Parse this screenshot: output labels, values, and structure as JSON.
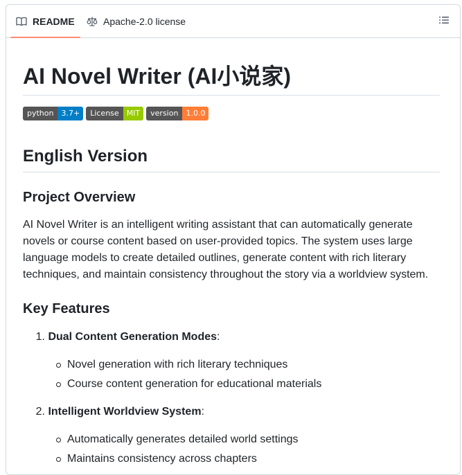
{
  "tabs": {
    "readme": "README",
    "license": "Apache-2.0 license"
  },
  "readme": {
    "title": "AI Novel Writer (AI小说家)",
    "badges": [
      {
        "label": "python",
        "value": "3.7+",
        "color": "#007ec6"
      },
      {
        "label": "License",
        "value": "MIT",
        "color": "#97ca00"
      },
      {
        "label": "version",
        "value": "1.0.0",
        "color": "#fe7d37"
      }
    ],
    "section_title": "English Version",
    "overview_heading": "Project Overview",
    "overview_text": "AI Novel Writer is an intelligent writing assistant that can automatically generate novels or course content based on user-provided topics. The system uses large language models to create detailed outlines, generate content with rich literary techniques, and maintain consistency throughout the story via a worldview system.",
    "features_heading": "Key Features",
    "features": [
      {
        "number": "1.",
        "title": "Dual Content Generation Modes",
        "suffix": ":",
        "items": [
          "Novel generation with rich literary techniques",
          "Course content generation for educational materials"
        ]
      },
      {
        "number": "2.",
        "title": "Intelligent Worldview System",
        "suffix": ":",
        "items": [
          "Automatically generates detailed world settings",
          "Maintains consistency across chapters"
        ]
      }
    ]
  }
}
